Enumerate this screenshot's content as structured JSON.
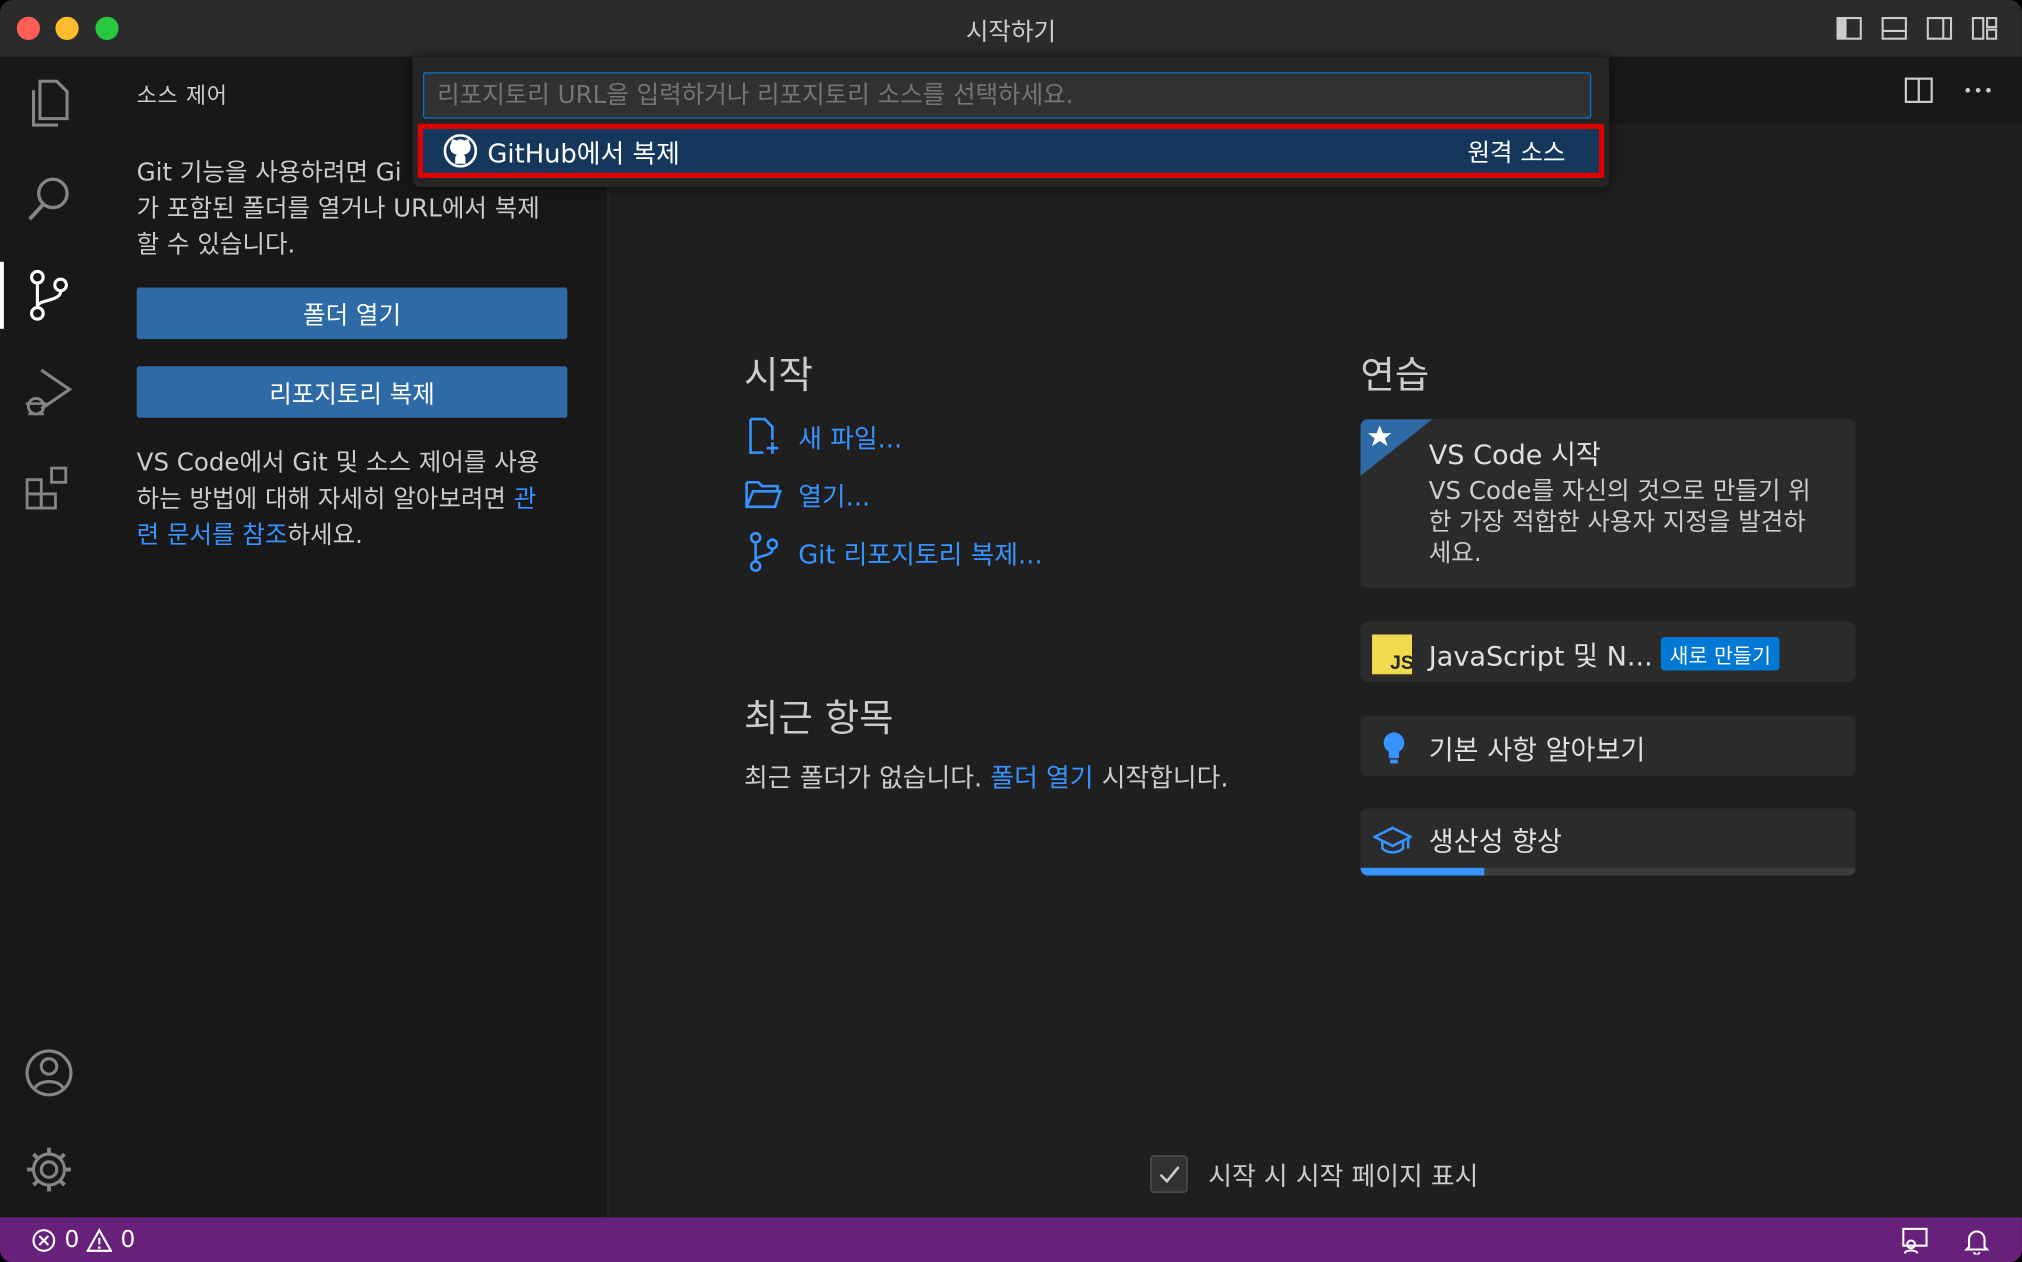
{
  "window": {
    "title": "시작하기"
  },
  "sidebar": {
    "title": "소스 제어",
    "intro_line1": "Git 기능을 사용하려면 Gi",
    "intro_line2": "가 포함된 폴더를 열거나 URL에서 복제",
    "intro_line3": "할 수 있습니다.",
    "open_folder_button": "폴더 열기",
    "clone_repo_button": "리포지토리 복제",
    "docs_line1": "VS Code에서 Git 및 소스 제어를 사용",
    "docs_line2_prefix": "하는 방법에 대해 자세히 알아보려면 ",
    "docs_line2_link": "관",
    "docs_line3_link": "련 문서를 참조",
    "docs_line3_suffix": "하세요."
  },
  "quick_pick": {
    "placeholder": "리포지토리 URL을 입력하거나 리포지토리 소스를 선택하세요.",
    "item_label": "GitHub에서 복제",
    "item_description": "원격 소스"
  },
  "welcome": {
    "start_heading": "시작",
    "start_items": [
      "새 파일...",
      "열기...",
      "Git 리포지토리 복제..."
    ],
    "recent_heading": "최근 항목",
    "recent_prefix": "최근 폴더가 없습니다. ",
    "recent_link": "폴더 열기",
    "recent_suffix": " 시작합니다.",
    "walkthrough_heading": "연습",
    "walkthroughs": [
      {
        "title": "VS Code 시작",
        "desc_line1": "VS Code를 자신의 것으로 만들기 위",
        "desc_line2": "한 가장 적합한 사용자 지정을 발견하",
        "desc_line3": "세요."
      },
      {
        "title": "JavaScript 및 N...",
        "badge": "새로 만들기"
      },
      {
        "title": "기본 사항 알아보기"
      },
      {
        "title": "생산성 향상",
        "progress": 0.25
      }
    ],
    "show_on_startup_label": "시작 시 시작 페이지 표시",
    "show_on_startup_checked": true
  },
  "statusbar": {
    "errors": "0",
    "warnings": "0"
  },
  "icons": {
    "activity": [
      "explorer-icon",
      "search-icon",
      "source-control-icon",
      "run-debug-icon",
      "extensions-icon",
      "accounts-icon",
      "manage-gear-icon"
    ]
  },
  "colors": {
    "accent": "#3794ff",
    "button": "#2d6aa6",
    "statusbar": "#68217a",
    "highlight_border": "#e00000"
  }
}
